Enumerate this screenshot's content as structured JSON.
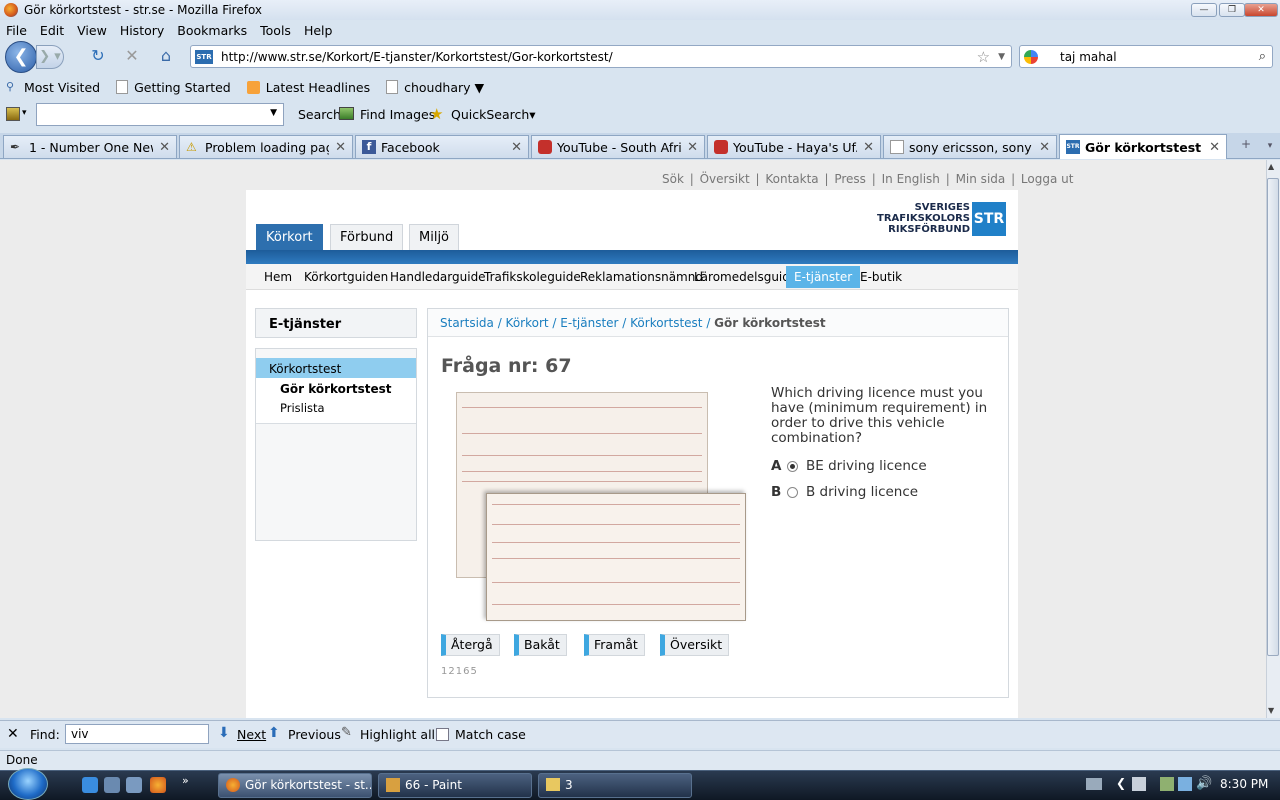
{
  "window": {
    "title": "Gör körkortstest - str.se - Mozilla Firefox"
  },
  "menu": [
    "File",
    "Edit",
    "View",
    "History",
    "Bookmarks",
    "Tools",
    "Help"
  ],
  "nav": {
    "url": "http://www.str.se/Korkort/E-tjanster/Korkortstest/Gor-korkortstest/",
    "search_value": "taj mahal"
  },
  "bookmarks": [
    "Most Visited",
    "Getting Started",
    "Latest Headlines",
    "choudhary ▼"
  ],
  "toolbar2": {
    "search_label": "Search",
    "find_images_label": "Find Images",
    "quicksearch_label": "QuickSearch▾"
  },
  "tabs": [
    {
      "label": "1 - Number One New..."
    },
    {
      "label": "Problem loading page"
    },
    {
      "label": "Facebook"
    },
    {
      "label": "YouTube - South Afri..."
    },
    {
      "label": "YouTube - Haya's Uf..."
    },
    {
      "label": "sony ericsson, sony e..."
    },
    {
      "label": "Gör körkortstest - s..."
    }
  ],
  "site": {
    "top_links": [
      "Sök",
      "Översikt",
      "Kontakta",
      "Press",
      "In English",
      "Min sida",
      "Logga ut"
    ],
    "logo_text": "SVERIGES TRAFIKSKOLORS RIKSFÖRBUND",
    "logo_mark": "STR",
    "main_tabs": [
      "Körkort",
      "Förbund",
      "Miljö"
    ],
    "sub_nav": [
      "Hem",
      "Körkortguiden",
      "Handledarguide",
      "Trafikskoleguide",
      "Reklamationsnämnd",
      "Läromedelsguide",
      "E-tjänster",
      "E-butik"
    ],
    "sidebar_title": "E-tjänster",
    "sidebar_current": "Körkortstest",
    "sidebar_sub": [
      "Gör körkortstest",
      "Prislista"
    ],
    "breadcrumb": [
      "Startsida",
      "Körkort",
      "E-tjänster",
      "Körkortstest"
    ],
    "breadcrumb_current": "Gör körkortstest",
    "question_title": "Fråga nr: 67",
    "question_text": "Which driving licence must you have (minimum requirement) in order to drive this vehicle combination?",
    "answers": [
      {
        "letter": "A",
        "label": "BE driving licence",
        "selected": true
      },
      {
        "letter": "B",
        "label": "B driving licence",
        "selected": false
      }
    ],
    "buttons": [
      "Återgå",
      "Bakåt",
      "Framåt",
      "Översikt"
    ],
    "question_id": "12165"
  },
  "findbar": {
    "label": "Find:",
    "value": "viv",
    "next": "Next",
    "previous": "Previous",
    "highlight": "Highlight all",
    "match_case": "Match case"
  },
  "status": "Done",
  "taskbar": {
    "items": [
      "Gör körkortstest - st...",
      "66 - Paint",
      "3"
    ],
    "clock": "8:30 PM"
  }
}
